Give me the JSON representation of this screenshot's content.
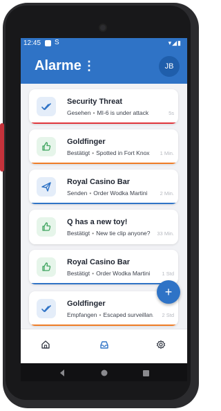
{
  "status_bar": {
    "time": "12:45",
    "s_glyph": "S",
    "right_icons": "▾◢▮"
  },
  "app_bar": {
    "title": "Alarme",
    "menu_glyph": "⋮",
    "avatar_initials": "JB"
  },
  "alarms": [
    {
      "title": "Security Threat",
      "status": "Gesehen",
      "message": "MI-6 is under attack",
      "time": "5s",
      "icon": "check-double-icon",
      "accent": "#e0353b",
      "icon_bg": "#e4edf9",
      "icon_color": "#2f73c6"
    },
    {
      "title": "Goldfinger",
      "status": "Bestätigt",
      "message": "Spotted in Fort Knox",
      "time": "1 Min.",
      "icon": "thumbs-up-icon",
      "accent": "#ef7c26",
      "icon_bg": "#e6f5ea",
      "icon_color": "#3da35d"
    },
    {
      "title": "Royal Casino Bar",
      "status": "Senden",
      "message": "Order Wodka Martini",
      "time": "2 Min.",
      "icon": "send-icon",
      "accent": "#2f73c6",
      "icon_bg": "#e4edf9",
      "icon_color": "#2f73c6"
    },
    {
      "title": "Q has a new toy!",
      "status": "Bestätigt",
      "message": "New tie clip anyone?",
      "time": "33 Min.",
      "icon": "thumbs-up-icon",
      "accent": "#ffffff",
      "icon_bg": "#e6f5ea",
      "icon_color": "#3da35d"
    },
    {
      "title": "Royal Casino Bar",
      "status": "Bestätigt",
      "message": "Order Wodka Martini",
      "time": "1 Std",
      "icon": "thumbs-up-icon",
      "accent": "#2f73c6",
      "icon_bg": "#e6f5ea",
      "icon_color": "#3da35d"
    },
    {
      "title": "Goldfinger",
      "status": "Empfangen",
      "message": "Escaped surveillan...",
      "time": "2 Std",
      "icon": "check-double-icon",
      "accent": "#ef7c26",
      "icon_bg": "#e4edf9",
      "icon_color": "#2f73c6"
    }
  ],
  "fab": {
    "label": "+"
  },
  "bottom_nav": [
    {
      "name": "home",
      "icon": "home-icon"
    },
    {
      "name": "inbox",
      "icon": "inbox-icon"
    },
    {
      "name": "settings",
      "icon": "gear-icon"
    }
  ],
  "colors": {
    "primary": "#2f73c6",
    "surface": "#f1f2f5",
    "device_accent": "#c4323b"
  }
}
